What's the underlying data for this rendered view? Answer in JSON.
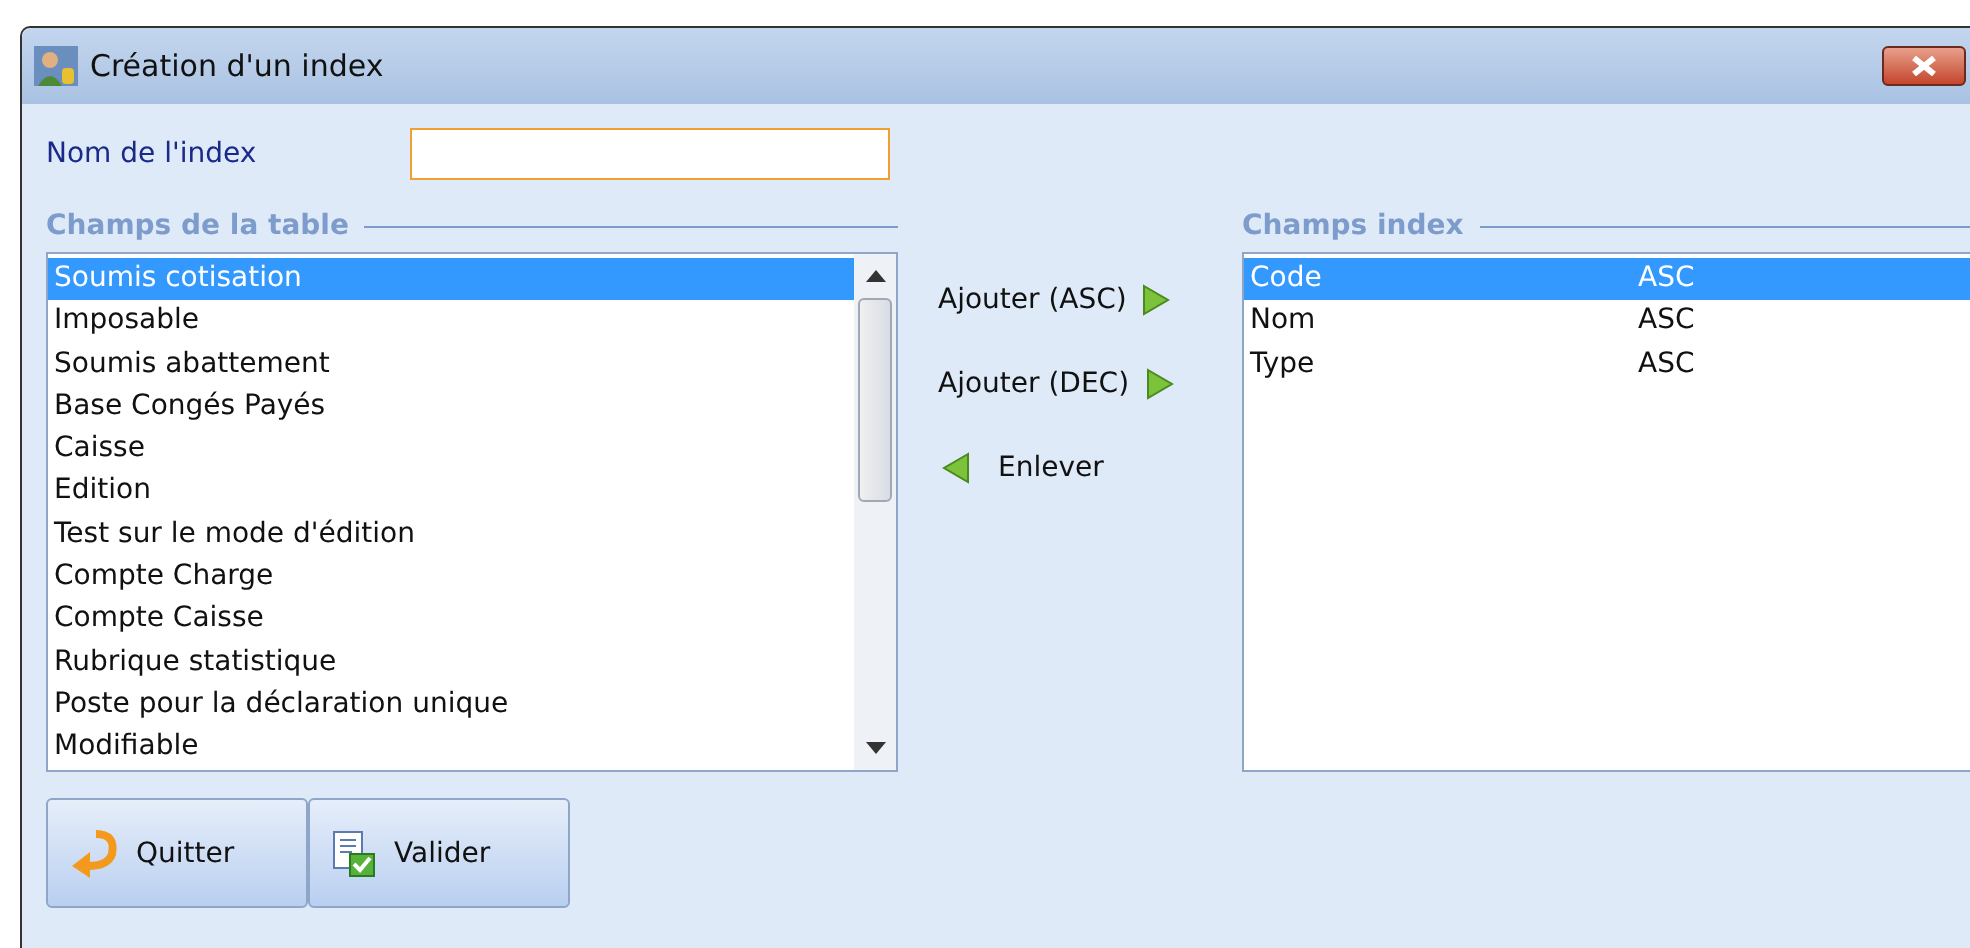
{
  "window": {
    "title": "Création d'un index"
  },
  "index_name": {
    "label": "Nom de l'index"
  },
  "table_fields": {
    "heading": "Champs de la table",
    "items": [
      {
        "label": "Soumis cotisation",
        "selected": true
      },
      {
        "label": "Imposable",
        "selected": false
      },
      {
        "label": "Soumis abattement",
        "selected": false
      },
      {
        "label": "Base Congés Payés",
        "selected": false
      },
      {
        "label": "Caisse",
        "selected": false
      },
      {
        "label": "Edition",
        "selected": false
      },
      {
        "label": "Test sur le mode d'édition",
        "selected": false
      },
      {
        "label": "Compte Charge",
        "selected": false
      },
      {
        "label": "Compte Caisse",
        "selected": false
      },
      {
        "label": "Rubrique statistique",
        "selected": false
      },
      {
        "label": "Poste pour la déclaration unique",
        "selected": false
      },
      {
        "label": "Modifiable",
        "selected": false
      }
    ]
  },
  "actions": [
    {
      "label": "Ajouter (ASC)",
      "kind": "add"
    },
    {
      "label": "Ajouter (DEC)",
      "kind": "add"
    },
    {
      "label": "Enlever",
      "kind": "remove"
    }
  ],
  "index_fields": {
    "heading": "Champs index",
    "items": [
      {
        "field": "Code",
        "order": "ASC",
        "selected": true
      },
      {
        "field": "Nom",
        "order": "ASC",
        "selected": false
      },
      {
        "field": "Type",
        "order": "ASC",
        "selected": false
      }
    ]
  },
  "buttons": [
    {
      "label": "Quitter",
      "kind": "quit"
    },
    {
      "label": "Valider",
      "kind": "validate"
    }
  ]
}
